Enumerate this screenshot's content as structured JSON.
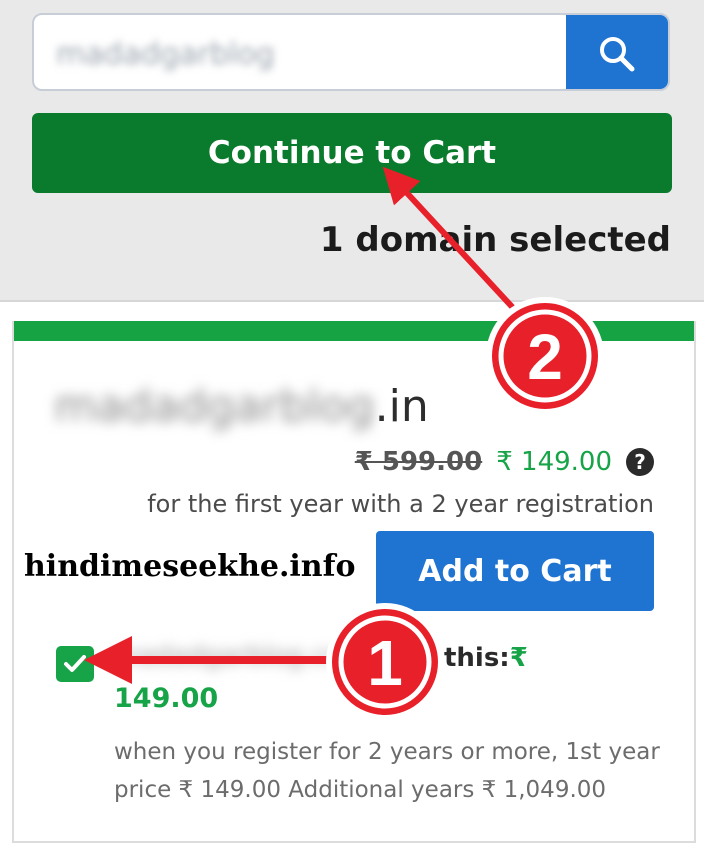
{
  "search": {
    "value": "madadgarblog",
    "button_icon": "search-icon"
  },
  "cart": {
    "continue_label": "Continue to Cart",
    "selected_count": "1 domain selected"
  },
  "domain_card": {
    "name_blurred": "madadgarblog",
    "extension": ".in",
    "old_price": "₹ 599.00",
    "new_price": "₹ 149.00",
    "help_icon": "?",
    "price_note": "for the first year with a 2 year registration",
    "add_label": "Add to Cart"
  },
  "watermark": "hindimeseekhe.info",
  "offer": {
    "checked": true,
    "blurred_text": "madadgarblog.com",
    "label_tail": "l this:",
    "currency": "₹",
    "price": "149.00",
    "description": "when you register for 2 years or more, 1st year price ₹ 149.00 Additional years ₹ 1,049.00"
  },
  "annotations": {
    "step1": "1",
    "step2": "2"
  },
  "colors": {
    "continue_green": "#0a7a2c",
    "accent_green": "#17a347",
    "button_blue": "#1f73d1",
    "annotation_red": "#e8202a"
  }
}
